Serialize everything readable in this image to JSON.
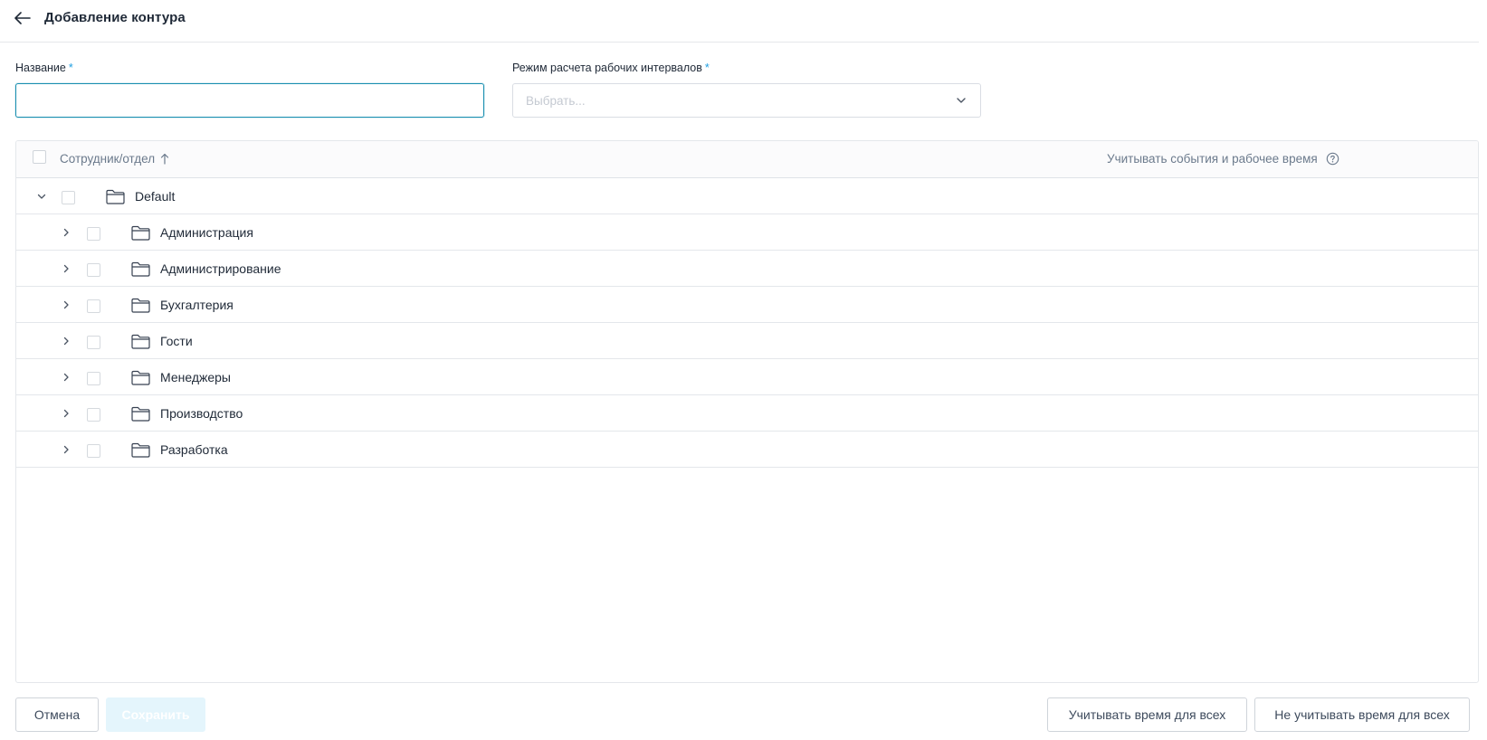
{
  "header": {
    "title": "Добавление контура"
  },
  "form": {
    "name_label": "Название",
    "name_value": "",
    "mode_label": "Режим расчета рабочих интервалов",
    "mode_placeholder": "Выбрать...",
    "required_mark": "*"
  },
  "table": {
    "col_employee": "Сотрудник/отдел",
    "col_track": "Учитывать события и рабочее время",
    "root": {
      "label": "Default",
      "expanded": true
    },
    "children": [
      {
        "label": "Администрация"
      },
      {
        "label": "Администрирование"
      },
      {
        "label": "Бухгалтерия"
      },
      {
        "label": "Гости"
      },
      {
        "label": "Менеджеры"
      },
      {
        "label": "Производство"
      },
      {
        "label": "Разработка"
      }
    ]
  },
  "footer": {
    "cancel_label": "Отмена",
    "save_label": "Сохранить",
    "track_all_label": "Учитывать время для всех",
    "untrack_all_label": "Не учитывать время для всех"
  },
  "colors": {
    "accent": "#1a8fb0",
    "required": "#1e9ee0",
    "save_disabled_bg": "#e4f5fc"
  },
  "icons": {
    "back": "arrow-left-icon",
    "select": "chevron-down-icon",
    "sort": "sort-ascending-icon",
    "help": "question-circle-icon",
    "expand": "chevron-right-icon",
    "collapse": "chevron-down-icon",
    "folder": "folder-icon"
  }
}
